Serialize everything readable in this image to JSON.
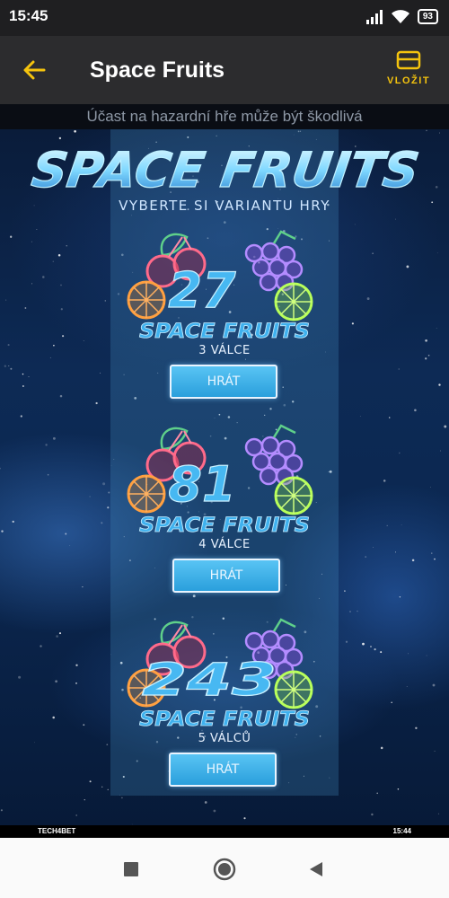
{
  "status_bar": {
    "time": "15:45",
    "battery": "93"
  },
  "app_bar": {
    "title": "Space Fruits",
    "deposit_label": "VLOŽIT"
  },
  "warning": "Účast na hazardní hře může být škodlivá",
  "game": {
    "logo_text": "SPACE FRUITS",
    "subtitle": "VYBERTE SI VARIANTU HRY",
    "variants": [
      {
        "number": "27",
        "name": "SPACE FRUITS",
        "reels": "3 VÁLCE",
        "play_label": "HRÁT"
      },
      {
        "number": "81",
        "name": "SPACE FRUITS",
        "reels": "4 VÁLCE",
        "play_label": "HRÁT"
      },
      {
        "number": "243",
        "name": "SPACE FRUITS",
        "reels": "5 VÁLCŮ",
        "play_label": "HRÁT"
      }
    ]
  },
  "info_bar": {
    "brand": "TECH4BET",
    "time": "15:44"
  },
  "colors": {
    "accent": "#f5c40e",
    "app_bar": "#2c2c2e",
    "button": "#2a9fdc"
  },
  "icons": [
    "signal-icon",
    "wifi-icon",
    "battery-icon",
    "back-arrow-icon",
    "wallet-icon",
    "recents-icon",
    "home-icon",
    "back-nav-icon"
  ]
}
